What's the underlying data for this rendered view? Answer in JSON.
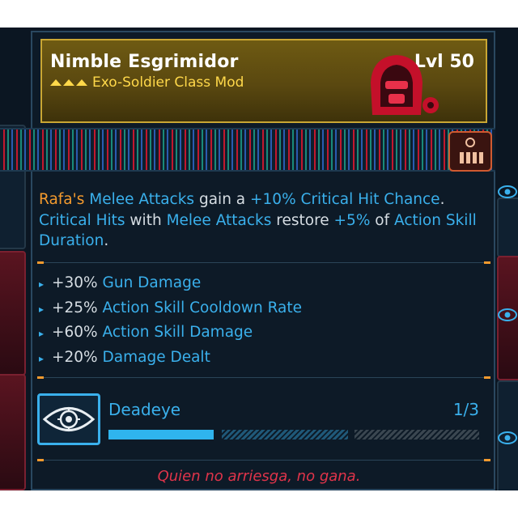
{
  "item": {
    "name": "Nimble Esgrimidor",
    "level": "Lvl 50",
    "type": "Exo-Soldier Class Mod"
  },
  "description": {
    "rafas": "Rafa's",
    "melee_attacks": "Melee Attacks",
    "gain_a": "gain a",
    "crit_chance": "+10% Critical Hit Chance",
    "period": ".",
    "critical_hits": "Critical Hits",
    "with": "with",
    "melee_attacks2": "Melee Attacks",
    "restore": "restore",
    "five_pct": "+5%",
    "of": "of",
    "action_skill_duration": "Action Skill Duration",
    "period2": "."
  },
  "stats": [
    {
      "value": "+30%",
      "label": "Gun Damage"
    },
    {
      "value": "+25%",
      "label": "Action Skill Cooldown Rate"
    },
    {
      "value": "+60%",
      "label": "Action Skill Damage"
    },
    {
      "value": "+20%",
      "label": "Damage Dealt"
    }
  ],
  "skill": {
    "name": "Deadeye",
    "rank": "1/3",
    "rank_current": 1,
    "rank_max": 3,
    "icon": "eye-target-icon"
  },
  "flavor_text": "Quien no arriesga, no gana.",
  "colors": {
    "gold": "#c9a633",
    "orange": "#f39a2e",
    "blue": "#3ab0ec",
    "red_flavor": "#e0344a"
  }
}
